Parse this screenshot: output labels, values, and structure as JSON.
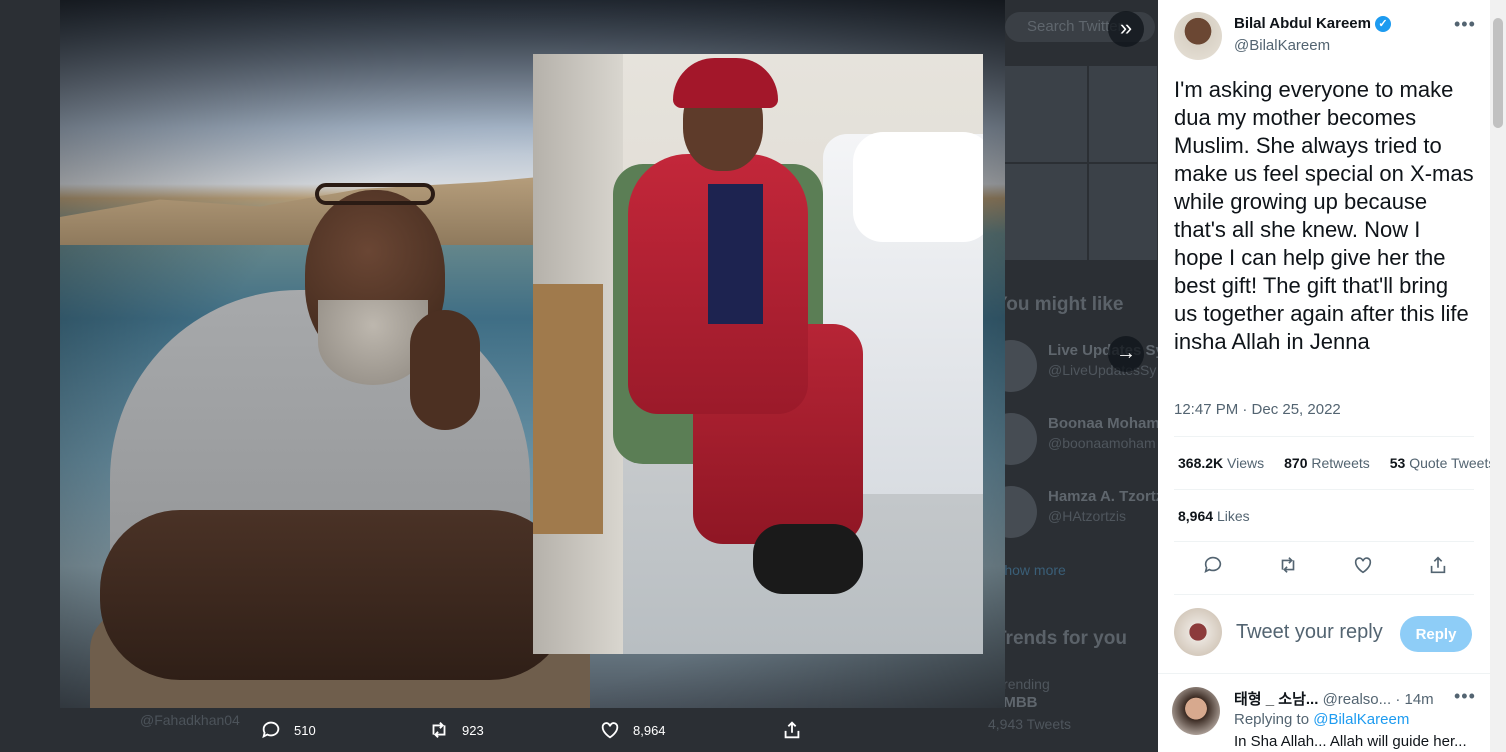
{
  "background": {
    "search_placeholder": "Search Twitter",
    "section_might_like": "You might like",
    "suggestions": [
      {
        "name": "Live Updates Sy",
        "handle": "@LiveUpdatesSy"
      },
      {
        "name": "Boonaa Mohamm",
        "handle": "@boonaamoham"
      },
      {
        "name": "Hamza A. Tzortzi",
        "handle": "@HAtzortzis"
      }
    ],
    "show_more": "Show more",
    "section_trends": "Trends for you",
    "trend_context": "Trending",
    "trend_name": "#MBB",
    "trend_count": "4,943 Tweets",
    "underlying_handle": "@Fahadkhan04"
  },
  "media_bar": {
    "replies": "510",
    "retweets": "923",
    "likes": "8,964"
  },
  "tweet": {
    "author_name": "Bilal Abdul Kareem",
    "author_handle": "@BilalKareem",
    "verified_mark": "✓",
    "text": "I'm asking everyone to make dua my mother becomes Muslim. She always tried to make us feel special on X-mas while growing up because that's all she knew. Now I hope I can help give her the best gift! The gift that'll bring us together again after this life insha Allah in Jenna",
    "time": "12:47 PM · Dec 25, 2022",
    "views_count": "368.2K",
    "views_label": "Views",
    "retweets_count": "870",
    "retweets_label": "Retweets",
    "quotes_count": "53",
    "quotes_label": "Quote Tweets",
    "likes_count": "8,964",
    "likes_label": "Likes"
  },
  "reply_box": {
    "placeholder": "Tweet your reply",
    "button": "Reply"
  },
  "replies": [
    {
      "name": "태형 _ 소남...",
      "handle": "@realso...",
      "time": "· 14m",
      "replying_prefix": "Replying to ",
      "replying_to": "@BilalKareem",
      "text": "In Sha Allah... Allah will guide her..."
    }
  ],
  "colors": {
    "accent": "#1d9bf0",
    "reply_button": "#8ecdf7",
    "muted_text": "#536471"
  },
  "icons": {
    "expand": "double-chevron-right-icon",
    "next": "arrow-right-icon",
    "reply": "comment-icon",
    "retweet": "retweet-icon",
    "like": "heart-icon",
    "share": "share-icon",
    "more": "more-dots-icon",
    "verified": "verified-badge-icon"
  }
}
